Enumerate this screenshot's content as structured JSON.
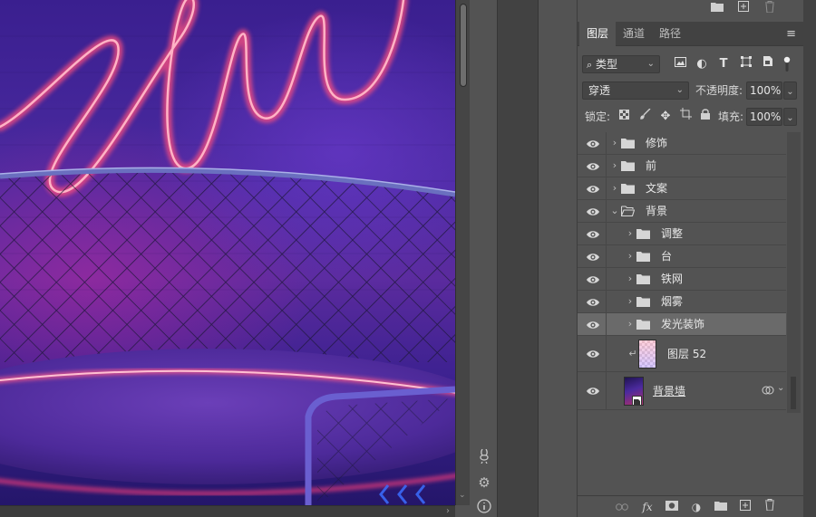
{
  "panel": {
    "tabs": [
      {
        "label": "图层",
        "active": true
      },
      {
        "label": "通道",
        "active": false
      },
      {
        "label": "路径",
        "active": false
      }
    ],
    "filter": {
      "label": "类型"
    },
    "blend_mode": "穿透",
    "opacity_label": "不透明度:",
    "opacity_value": "100%",
    "lock_label": "锁定:",
    "fill_label": "填充:",
    "fill_value": "100%",
    "layers": [
      {
        "name": "修饰",
        "type": "group",
        "indent": 0,
        "expanded": false,
        "visible": true
      },
      {
        "name": "前",
        "type": "group",
        "indent": 0,
        "expanded": false,
        "visible": true
      },
      {
        "name": "文案",
        "type": "group",
        "indent": 0,
        "expanded": false,
        "visible": true
      },
      {
        "name": "背景",
        "type": "group",
        "indent": 0,
        "expanded": true,
        "visible": true
      },
      {
        "name": "调整",
        "type": "group",
        "indent": 1,
        "expanded": false,
        "visible": true
      },
      {
        "name": "台",
        "type": "group",
        "indent": 1,
        "expanded": false,
        "visible": true
      },
      {
        "name": "铁网",
        "type": "group",
        "indent": 1,
        "expanded": false,
        "visible": true
      },
      {
        "name": "烟雾",
        "type": "group",
        "indent": 1,
        "expanded": false,
        "visible": true
      },
      {
        "name": "发光装饰",
        "type": "group",
        "indent": 1,
        "expanded": false,
        "visible": true,
        "selected": true
      },
      {
        "name": "图层 52",
        "type": "clipped-layer",
        "indent": 1,
        "visible": true
      },
      {
        "name": "背景墙",
        "type": "smart-object",
        "indent": 1,
        "visible": true
      }
    ]
  },
  "colors": {
    "panel_bg": "#535353",
    "selected_row": "#6a6a6a",
    "neon_pink": "#ff5a7a",
    "canvas_purple": "#4a2aa0"
  }
}
